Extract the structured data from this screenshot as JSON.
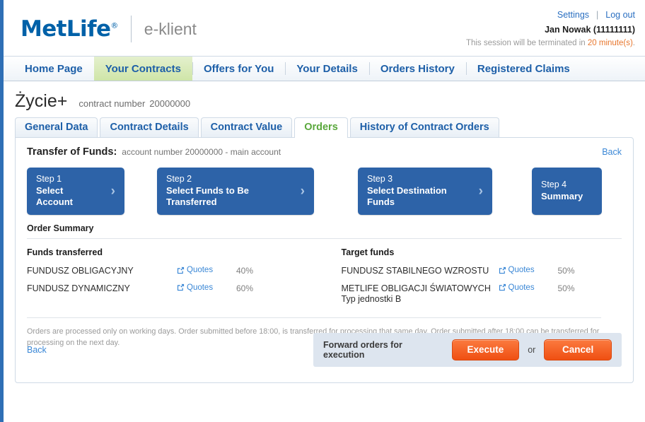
{
  "header": {
    "brand": "MetLife",
    "brand_reg": "®",
    "subbrand": "e-klient",
    "settings_label": "Settings",
    "separator": "|",
    "logout_label": "Log out",
    "user": "Jan Nowak (11111111)",
    "session_prefix": "This session will be terminated in ",
    "session_timer": "20 minute(s)",
    "session_suffix": ".",
    "brand_color": "#0061a8",
    "timer_color": "#e8762c"
  },
  "main_nav": {
    "items": [
      {
        "label": "Home Page",
        "active": false
      },
      {
        "label": "Your Contracts",
        "active": true
      },
      {
        "label": "Offers for You",
        "active": false
      },
      {
        "label": "Your Details",
        "active": false
      },
      {
        "label": "Orders History",
        "active": false
      },
      {
        "label": "Registered Claims",
        "active": false
      }
    ]
  },
  "contract": {
    "name": "Życie+",
    "meta_label": "contract number",
    "number": "20000000"
  },
  "sub_tabs": {
    "items": [
      {
        "label": "General Data",
        "active": false
      },
      {
        "label": "Contract Details",
        "active": false
      },
      {
        "label": "Contract Value",
        "active": false
      },
      {
        "label": "Orders",
        "active": true
      },
      {
        "label": "History of Contract Orders",
        "active": false
      }
    ]
  },
  "panel": {
    "title": "Transfer of Funds:",
    "subtitle": "account number 20000000 - main account",
    "back_label": "Back"
  },
  "steps": [
    {
      "number": "Step 1",
      "label": "Select Account",
      "chevron": "›"
    },
    {
      "number": "Step 2",
      "label": "Select Funds to Be Transferred",
      "chevron": "›"
    },
    {
      "number": "Step 3",
      "label": "Select Destination Funds",
      "chevron": "›"
    },
    {
      "number": "Step 4",
      "label": "Summary",
      "chevron": ""
    }
  ],
  "order_summary": {
    "title": "Order Summary",
    "transferred": {
      "heading": "Funds transferred",
      "rows": [
        {
          "name": "FUNDUSZ OBLIGACYJNY",
          "quotes_label": "Quotes",
          "percent": "40%"
        },
        {
          "name": "FUNDUSZ DYNAMICZNY",
          "quotes_label": "Quotes",
          "percent": "60%"
        }
      ]
    },
    "target": {
      "heading": "Target funds",
      "rows": [
        {
          "name": "FUNDUSZ STABILNEGO WZROSTU",
          "quotes_label": "Quotes",
          "percent": "50%"
        },
        {
          "name": "METLIFE OBLIGACJI ŚWIATOWYCH\nTyp jednostki B",
          "quotes_label": "Quotes",
          "percent": "50%"
        }
      ]
    }
  },
  "disclaimer": "Orders are processed only on working days. Order submitted before 18:00,  is transferred for processing that same day. Order submitted after 18:00  can be transferred for processing on the next day.",
  "footer": {
    "back_label": "Back",
    "exec_label": "Forward orders for execution",
    "execute_label": "Execute",
    "or_label": "or",
    "cancel_label": "Cancel",
    "button_color": "#f05a22"
  }
}
